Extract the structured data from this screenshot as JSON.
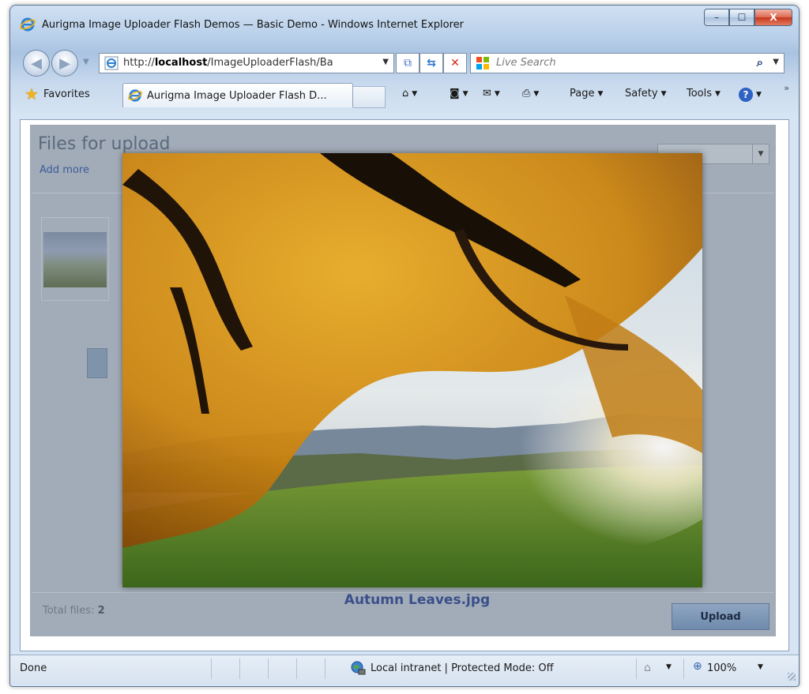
{
  "window": {
    "title": "Aurigma Image Uploader Flash Demos — Basic Demo - Windows Internet Explorer",
    "controls": {
      "minimize": "–",
      "maximize": "☐",
      "close": "X"
    }
  },
  "address_bar": {
    "url_prefix": "http://",
    "url_host": "localhost",
    "url_path": "/ImageUploaderFlash/Ba",
    "search_placeholder": "Live Search"
  },
  "favorites_bar": {
    "favorites_label": "Favorites",
    "tab_title": "Aurigma Image Uploader Flash D...",
    "commands": {
      "page": "Page",
      "safety": "Safety",
      "tools": "Tools"
    }
  },
  "uploader": {
    "title": "Files for upload",
    "add_more": "Add more",
    "total_label": "Total files:",
    "total_count": "2",
    "upload_label": "Upload",
    "preview_caption": "Autumn Leaves.jpg"
  },
  "status_bar": {
    "status": "Done",
    "zone": "Local intranet | Protected Mode: Off",
    "zoom": "100%"
  },
  "icons": [
    "ie-icon",
    "back-icon",
    "forward-icon",
    "compatibility-icon",
    "refresh-icon",
    "stop-icon",
    "live-search-icon",
    "search-icon",
    "favorites-star-icon",
    "home-icon",
    "feeds-icon",
    "mail-icon",
    "print-icon",
    "help-icon",
    "intranet-globe-icon",
    "security-icon",
    "zoom-icon"
  ]
}
